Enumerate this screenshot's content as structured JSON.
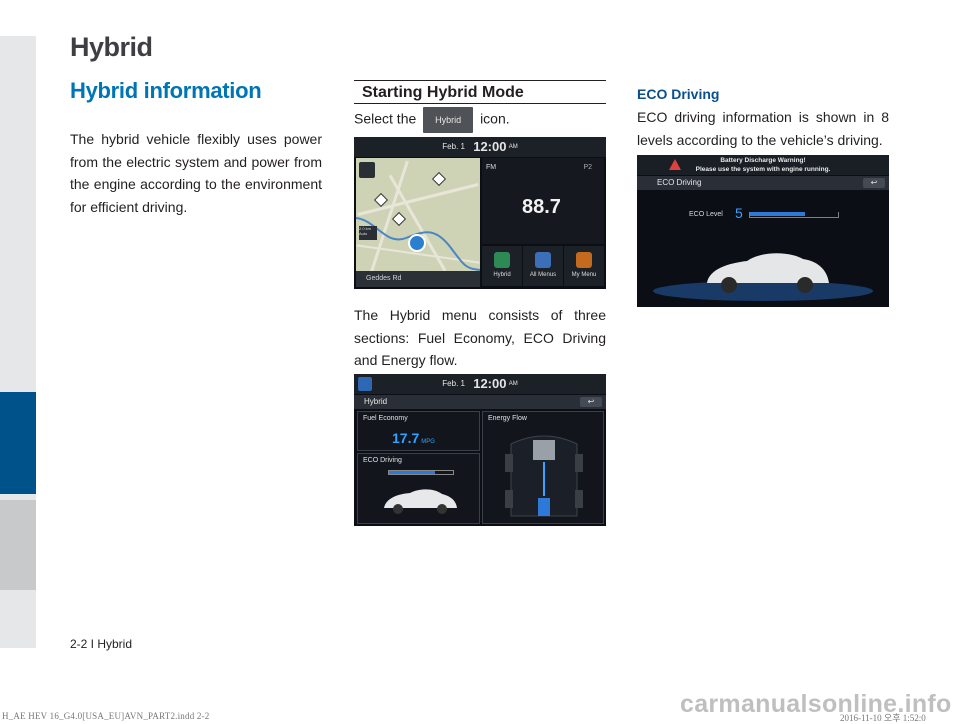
{
  "header": {
    "chapter_title": "Hybrid"
  },
  "column1": {
    "section_title": "Hybrid information",
    "body": "The hybrid vehicle flexibly uses power from the electric system and power from the engine according to the environment for efficient driving."
  },
  "column2": {
    "subsection_title": "Starting Hybrid Mode",
    "select_prefix": "Select the",
    "select_chip": "Hybrid",
    "select_suffix": "icon.",
    "body": "The Hybrid menu consists of three sections: Fuel Economy, ECO Driving and Energy flow."
  },
  "column3": {
    "heading": "ECO Driving",
    "body": "ECO driving information is shown in 8 levels according to the vehicle’s driving."
  },
  "screen_home": {
    "date": "Feb.  1",
    "time": "12:00",
    "ampm": "AM",
    "street": "Geddes Rd",
    "scale": "2.0 km",
    "scale_mode": "Auto",
    "radio_band": "FM",
    "preset": "P2",
    "frequency": "88.7",
    "tiles": [
      {
        "label": "Hybrid",
        "icon": "leaf-icon",
        "color": "#2e8a55"
      },
      {
        "label": "All Menus",
        "icon": "grid-icon",
        "color": "#3d6fb8"
      },
      {
        "label": "My Menu",
        "icon": "folder-icon",
        "color": "#c46a1e"
      }
    ]
  },
  "screen_hybrid": {
    "date": "Feb.  1",
    "time": "12:00",
    "ampm": "AM",
    "title": "Hybrid",
    "back": "↩",
    "fuel_economy_title": "Fuel Economy",
    "fuel_economy_value": "17.7",
    "fuel_economy_unit": "MPG",
    "eco_driving_title": "ECO Driving",
    "eco_driving_level": 0.72,
    "energy_flow_title": "Energy Flow"
  },
  "screen_eco": {
    "warning_line1": "Battery Discharge Warning!",
    "warning_line2": "Please use the system with engine running.",
    "title": "ECO Driving",
    "back": "↩",
    "eco_level_label": "ECO Level",
    "eco_level_value": "5",
    "eco_level_fraction": 0.625
  },
  "footer": {
    "page_number": "2-2 I Hybrid",
    "print_slug": "H_AE HEV 16_G4.0[USA_EU]AVN_PART2.indd   2-2",
    "print_date": "2016-11-10   오후 1:52:0",
    "watermark": "carmanualsonline.info"
  },
  "colors": {
    "accent_blue": "#0075b6",
    "tab_blue": "#00528a",
    "sidebar_grey": "#e6e7e8"
  }
}
